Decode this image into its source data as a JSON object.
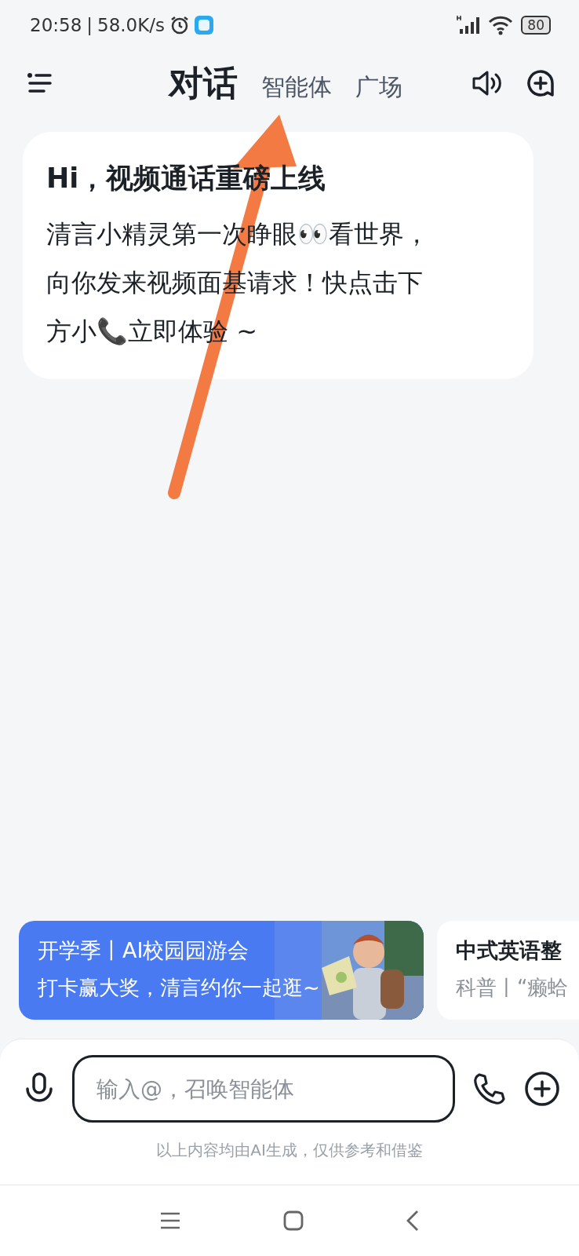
{
  "status_bar": {
    "time": "20:58",
    "separator": "|",
    "speed": "58.0K/s",
    "battery": "80"
  },
  "header": {
    "tabs": [
      {
        "label": "对话",
        "selected": true
      },
      {
        "label": "智能体",
        "selected": false
      },
      {
        "label": "广场",
        "selected": false
      }
    ]
  },
  "message_card": {
    "title": "Hi，视频通话重磅上线",
    "body_lines": [
      "清言小精灵第一次睁眼👀看世界，",
      "向你发来视频面基请求！快点击下",
      "方小📞立即体验 ~"
    ]
  },
  "banners": [
    {
      "kind": "promo",
      "title": "开学季丨AI校园园游会",
      "subtitle": "打卡赢大奖，清言约你一起逛~"
    },
    {
      "kind": "plain",
      "title": "中式英语整",
      "subtitle": "科普丨“癞蛤"
    }
  ],
  "composer": {
    "placeholder": "输入@，召唤智能体",
    "disclaimer": "以上内容均由AI生成，仅供参考和借鉴"
  }
}
